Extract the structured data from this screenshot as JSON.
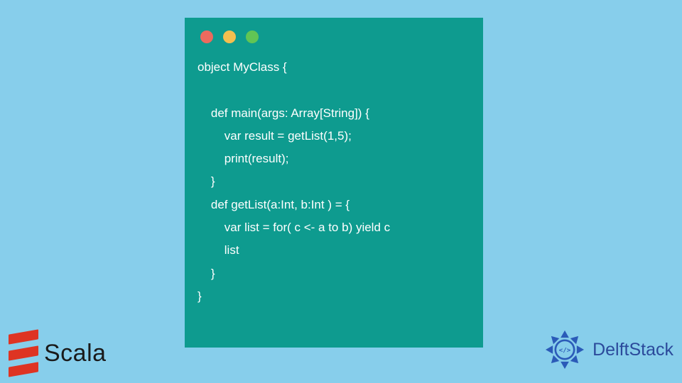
{
  "window": {
    "buttons": [
      "close",
      "minimize",
      "maximize"
    ]
  },
  "code": {
    "lines": [
      "object MyClass {",
      "",
      "    def main(args: Array[String]) {",
      "        var result = getList(1,5);",
      "        print(result);",
      "    }",
      "    def getList(a:Int, b:Int ) = {",
      "        var list = for( c <- a to b) yield c",
      "        list",
      "    }",
      "}"
    ]
  },
  "logos": {
    "scala": "Scala",
    "delft": "DelftStack"
  }
}
